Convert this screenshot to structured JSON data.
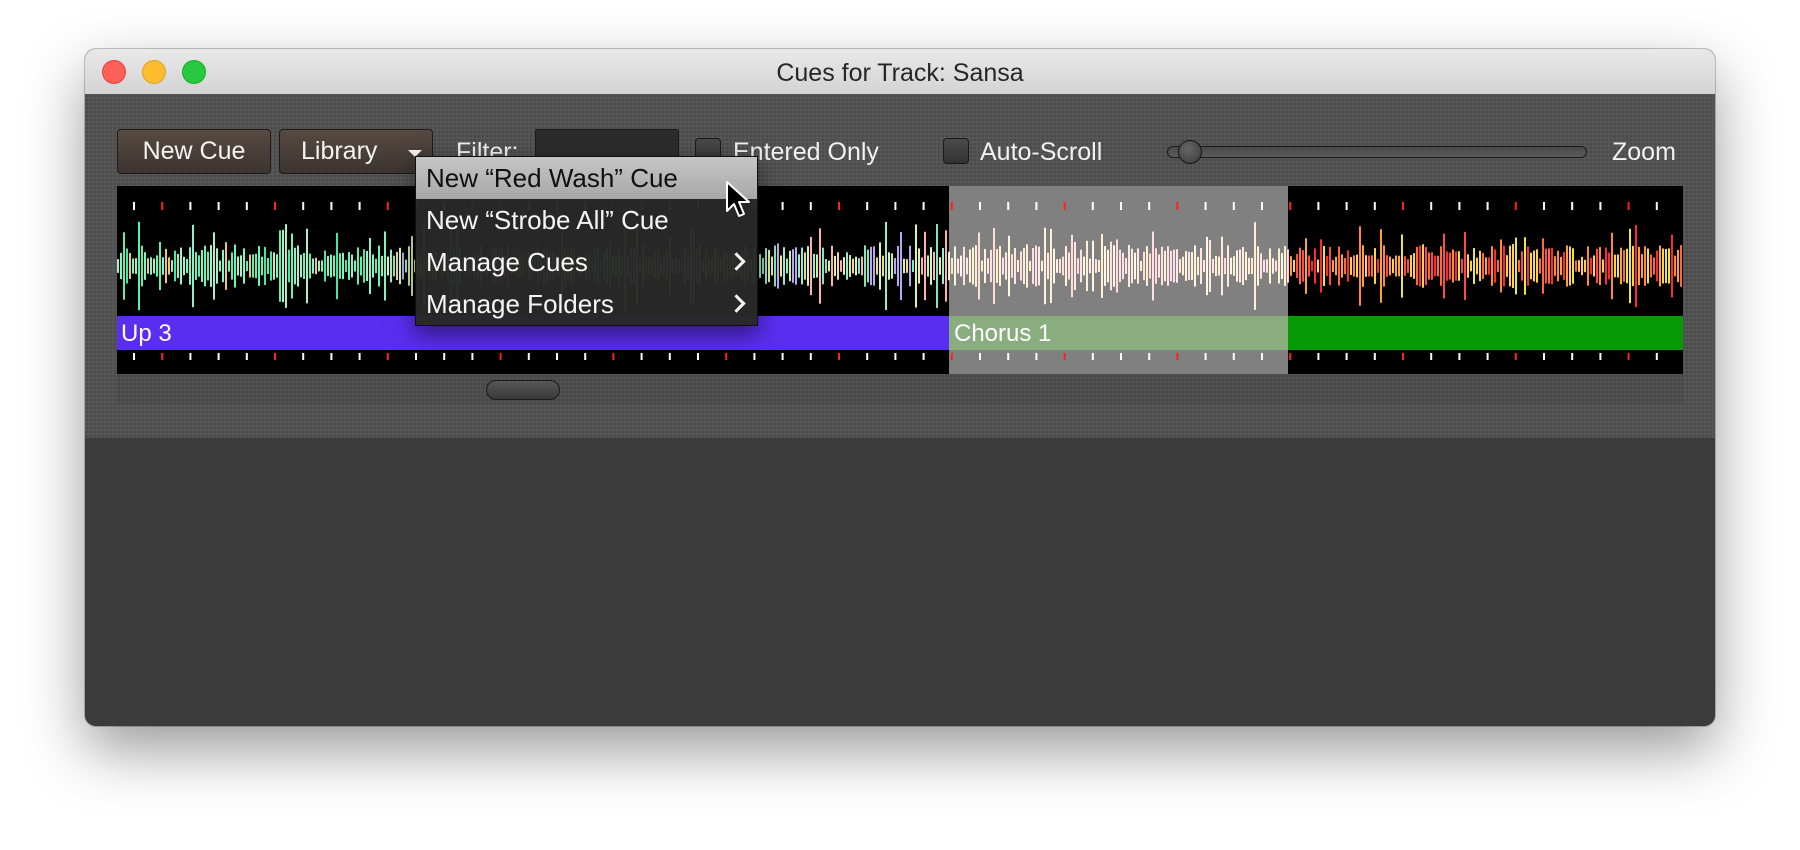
{
  "window": {
    "title": "Cues for Track: Sansa"
  },
  "toolbar": {
    "new_cue_label": "New Cue",
    "library_label": "Library",
    "filter_label": "Filter:",
    "filter_value": "",
    "entered_only_label": "Entered Only",
    "entered_only_checked": false,
    "auto_scroll_label": "Auto-Scroll",
    "auto_scroll_checked": false,
    "zoom_label": "Zoom",
    "zoom_level": 0.05
  },
  "waveform": {
    "phrases": [
      {
        "label": "Up 3",
        "color": "#5a2ef0"
      },
      {
        "label": "Chorus 1",
        "color": "#8fd17e"
      },
      {
        "label": "",
        "color": "#079a07"
      }
    ],
    "selected_phrase": "Chorus 1",
    "beat_marker_color": "#ffffff",
    "bar_marker_color": "#ff2020"
  },
  "scrollbar": {
    "position": 0.2
  },
  "library_menu": {
    "items": [
      {
        "label": "New “Red Wash” Cue",
        "submenu": false,
        "highlighted": true
      },
      {
        "label": "New “Strobe All” Cue",
        "submenu": false,
        "highlighted": false
      },
      {
        "label": "Manage Cues",
        "submenu": true,
        "highlighted": false
      },
      {
        "label": "Manage Folders",
        "submenu": true,
        "highlighted": false
      }
    ]
  },
  "icons": {
    "library_dropdown": "caret-down-icon",
    "submenu": "chevron-right-icon",
    "pointer": "mouse-cursor-icon"
  }
}
